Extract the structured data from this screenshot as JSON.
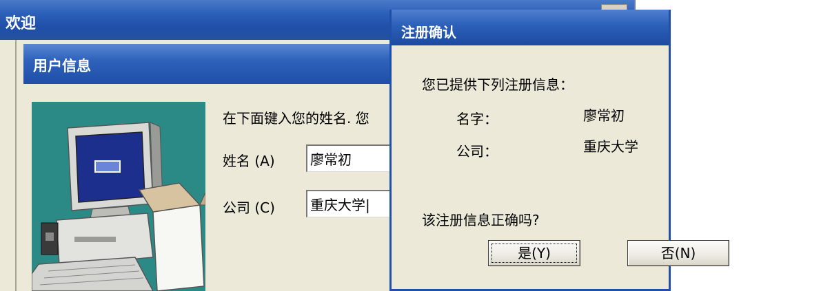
{
  "welcome_window": {
    "title": "欢迎"
  },
  "user_info": {
    "title": "用户信息",
    "prompt": "在下面键入您的姓名. 您",
    "name_label": "姓名",
    "name_accel": "(A)",
    "name_value": "廖常初",
    "company_label": "公司",
    "company_accel": "(C)",
    "company_value": "重庆大学|"
  },
  "confirm_dialog": {
    "title": "注册确认",
    "intro": "您已提供下列注册信息：",
    "name_label": "名字：",
    "name_value": "廖常初",
    "company_label": "公司：",
    "company_value": "重庆大学",
    "question": "该注册信息正确吗?",
    "yes_label": "是(Y)",
    "no_label": "否(N)"
  },
  "icons": {
    "illustration": "computer-with-box-illustration"
  }
}
